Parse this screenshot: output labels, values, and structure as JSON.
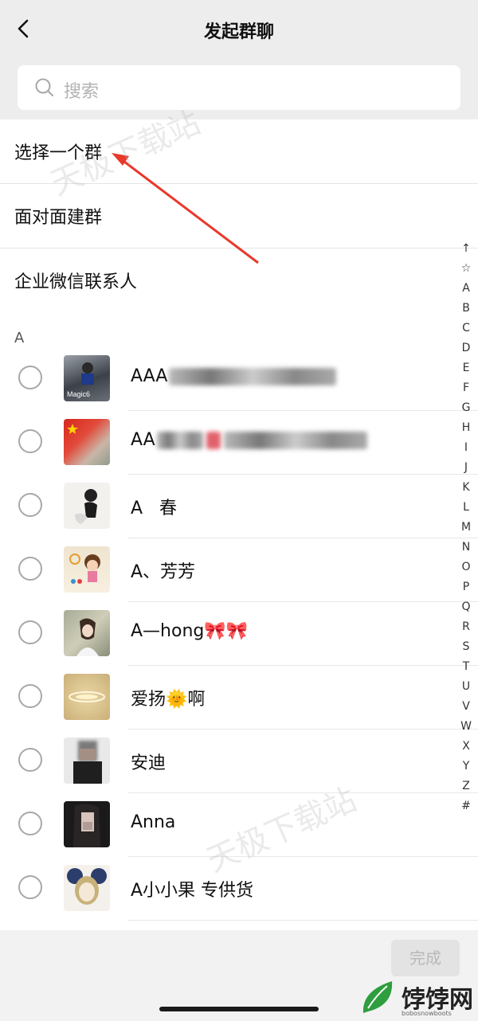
{
  "header": {
    "title": "发起群聊"
  },
  "search": {
    "placeholder": "搜索"
  },
  "menu": [
    {
      "label": "选择一个群"
    },
    {
      "label": "面对面建群"
    },
    {
      "label": "企业微信联系人"
    }
  ],
  "section_letter": "A",
  "contacts": [
    {
      "name_prefix": "AAA",
      "blurred": true,
      "avatar_label": "Magic6"
    },
    {
      "name_prefix": "AA",
      "blurred": true
    },
    {
      "name_prefix": "A   春"
    },
    {
      "name_prefix": "A、芳芳"
    },
    {
      "name_prefix": "A—hong🎀🎀"
    },
    {
      "name_prefix": "爱扬🌞啊"
    },
    {
      "name_prefix": "安迪"
    },
    {
      "name_prefix": "Anna"
    },
    {
      "name_prefix": "A小小果 专供货"
    }
  ],
  "index_letters": [
    "↑",
    "☆",
    "A",
    "B",
    "C",
    "D",
    "E",
    "F",
    "G",
    "H",
    "I",
    "J",
    "K",
    "L",
    "M",
    "N",
    "O",
    "P",
    "Q",
    "R",
    "S",
    "T",
    "U",
    "V",
    "W",
    "X",
    "Y",
    "Z",
    "#"
  ],
  "footer": {
    "done_label": "完成"
  },
  "watermark": "天极下载站",
  "logo": {
    "text": "饽饽网",
    "sub": "bobosnowboots"
  },
  "colors": {
    "accent_arrow": "#e8392b",
    "disabled_button": "#e3e3e3",
    "background": "#ededed"
  }
}
